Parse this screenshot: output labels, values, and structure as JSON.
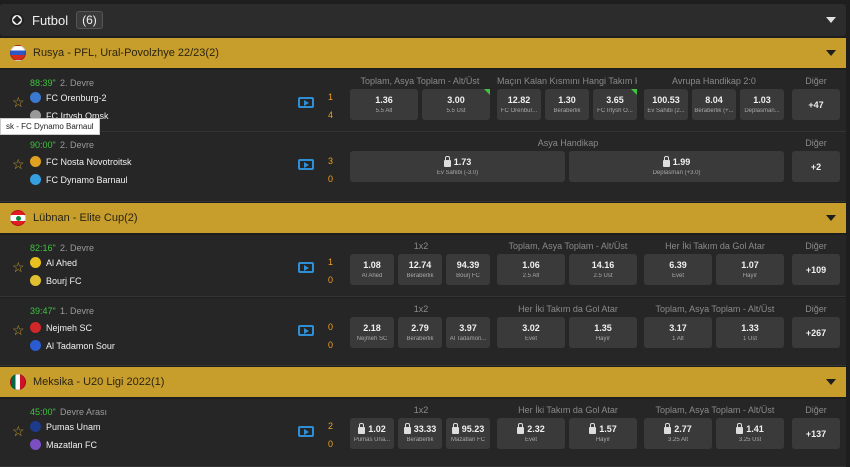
{
  "sport": {
    "title": "Futbol",
    "count": "(6)"
  },
  "tooltip": "sk - FC Dynamo Barnaul",
  "leagues": [
    {
      "name": "Rusya - PFL, Ural-Povolzhye 22/23(2)"
    },
    {
      "name": "Lübnan - Elite Cup(2)"
    },
    {
      "name": "Meksika - U20 Ligi 2022(1)"
    }
  ],
  "other_label": "Diğer",
  "matches": [
    {
      "time": "88:39\"",
      "half": "2. Devre",
      "home": "FC Orenburg-2",
      "away": "FC Irtysh Omsk",
      "home_score": "1",
      "away_score": "4",
      "markets": [
        "Toplam, Asya Toplam - Alt/Üst",
        "Maçın Kalan Kısmını Hangi Takım Ka...",
        "Avrupa Handikap 2:0"
      ],
      "odds": [
        {
          "v": "1.36",
          "l": "5.5 Alt"
        },
        {
          "v": "3.00",
          "l": "5.5 Üst"
        },
        {
          "v": "12.82",
          "l": "FC Orenbur..."
        },
        {
          "v": "1.30",
          "l": "Beraberlik"
        },
        {
          "v": "3.65",
          "l": "FC Irtysh O..."
        },
        {
          "v": "100.53",
          "l": "Ev Sahibi (2..."
        },
        {
          "v": "8.04",
          "l": "Beraberlik (+..."
        },
        {
          "v": "1.03",
          "l": "Deplasman..."
        }
      ],
      "more": "+47"
    },
    {
      "time": "90:00\"",
      "half": "2. Devre",
      "home": "FC Nosta Novotroitsk",
      "away": "FC Dynamo Barnaul",
      "home_score": "3",
      "away_score": "0",
      "markets": [
        "Asya Handikap"
      ],
      "odds": [
        {
          "v": "1.73",
          "l": "Ev Sahibi (-3.0)"
        },
        {
          "v": "1.99",
          "l": "Deplasman (+3.0)"
        }
      ],
      "more": "+2"
    },
    {
      "time": "82:16\"",
      "half": "2. Devre",
      "home": "Al Ahed",
      "away": "Bourj FC",
      "home_score": "1",
      "away_score": "0",
      "markets": [
        "1x2",
        "Toplam, Asya Toplam - Alt/Üst",
        "Her İki Takım da Gol Atar"
      ],
      "odds": [
        {
          "v": "1.08",
          "l": "Al Ahed"
        },
        {
          "v": "12.74",
          "l": "Beraberlik"
        },
        {
          "v": "94.39",
          "l": "Bourj FC"
        },
        {
          "v": "1.06",
          "l": "2.5 Alt"
        },
        {
          "v": "14.16",
          "l": "2.5 Üst"
        },
        {
          "v": "6.39",
          "l": "Evet"
        },
        {
          "v": "1.07",
          "l": "Hayır"
        }
      ],
      "more": "+109"
    },
    {
      "time": "39:47\"",
      "half": "1. Devre",
      "home": "Nejmeh SC",
      "away": "Al Tadamon Sour",
      "home_score": "0",
      "away_score": "0",
      "markets": [
        "1x2",
        "Her İki Takım da Gol Atar",
        "Toplam, Asya Toplam - Alt/Üst"
      ],
      "odds": [
        {
          "v": "2.18",
          "l": "Nejmeh SC"
        },
        {
          "v": "2.79",
          "l": "Beraberlik"
        },
        {
          "v": "3.97",
          "l": "Al Tadamon..."
        },
        {
          "v": "3.02",
          "l": "Evet"
        },
        {
          "v": "1.35",
          "l": "Hayır"
        },
        {
          "v": "3.17",
          "l": "1 Alt"
        },
        {
          "v": "1.33",
          "l": "1 Üst"
        }
      ],
      "more": "+267"
    },
    {
      "time": "45:00\"",
      "half": "Devre Arası",
      "home": "Pumas Unam",
      "away": "Mazatlan FC",
      "home_score": "2",
      "away_score": "0",
      "markets": [
        "1x2",
        "Her İki Takım da Gol Atar",
        "Toplam, Asya Toplam - Alt/Üst"
      ],
      "odds": [
        {
          "v": "1.02",
          "l": "Pumas Una..."
        },
        {
          "v": "33.33",
          "l": "Beraberlik"
        },
        {
          "v": "95.23",
          "l": "Mazatlan FC"
        },
        {
          "v": "2.32",
          "l": "Evet"
        },
        {
          "v": "1.57",
          "l": "Hayır"
        },
        {
          "v": "2.77",
          "l": "3.25 Alt"
        },
        {
          "v": "1.41",
          "l": "3.25 Üst"
        }
      ],
      "more": "+137"
    }
  ]
}
